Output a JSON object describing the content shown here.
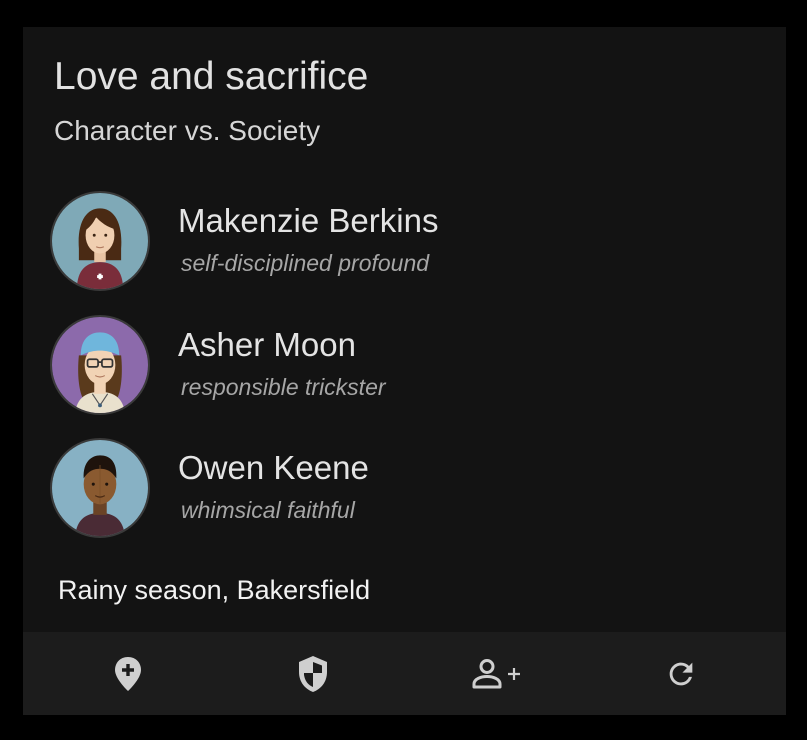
{
  "story": {
    "theme": "Love and sacrifice",
    "conflict": "Character vs. Society"
  },
  "characters": [
    {
      "name": "Makenzie Berkins",
      "traits": "self-disciplined profound",
      "avatar_icon": "woman-brown-hair-avatar"
    },
    {
      "name": "Asher Moon",
      "traits": "responsible trickster",
      "avatar_icon": "person-glasses-bandana-avatar"
    },
    {
      "name": "Owen Keene",
      "traits": "whimsical faithful",
      "avatar_icon": "man-dark-skin-avatar"
    }
  ],
  "setting": "Rainy season, Bakersfield",
  "toolbar": {
    "buttons": [
      {
        "icon": "add-location-icon"
      },
      {
        "icon": "shield-icon"
      },
      {
        "icon": "add-person-icon"
      },
      {
        "icon": "refresh-icon"
      }
    ]
  },
  "colors": {
    "background": "#000000",
    "card": "#131313",
    "toolbar": "#1c1c1c",
    "icon": "#cfcfcf"
  }
}
